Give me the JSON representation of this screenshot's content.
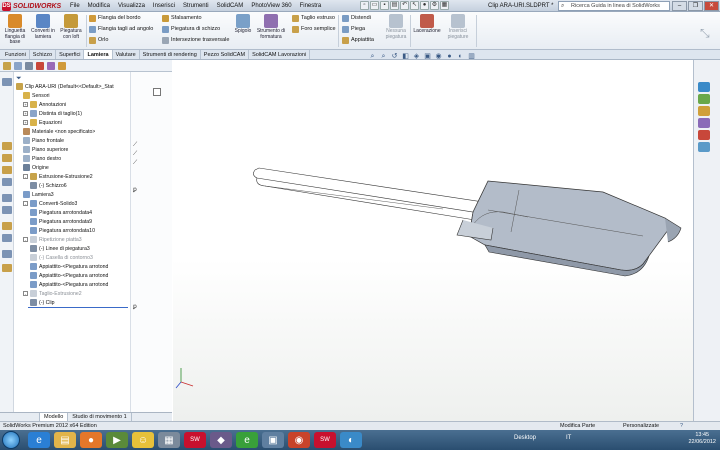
{
  "titlebar": {
    "logo": "SOLIDWORKS",
    "menu": [
      "File",
      "Modifica",
      "Visualizza",
      "Inserisci",
      "Strumenti",
      "SolidCAM",
      "PhotoView 360",
      "Finestra"
    ],
    "document_title": "Clip ARA-URI.SLDPRT *",
    "search_placeholder": "Ricerca Guida in linea di SolidWorks"
  },
  "ribbon": {
    "big_buttons": [
      {
        "label": "Linguetta flangia di base",
        "color": "#d98a2a"
      },
      {
        "label": "Converti in lamiera",
        "color": "#5a86c5"
      },
      {
        "label": "Piegatura con loft",
        "color": "#c59a3a"
      },
      {
        "label": "Spigolo",
        "color": "#7aa0c8"
      },
      {
        "label": "Strumento di formatura",
        "color": "#8f6fb0"
      },
      {
        "label": "Nessuna piegatura",
        "color": "#b7c2cf"
      },
      {
        "label": "Lacerazione",
        "color": "#c05a4a"
      },
      {
        "label": "Inserisci piegature",
        "color": "#b7c2cf"
      }
    ],
    "col1": [
      "Flangia del bordo",
      "Flangia tagli ad angolo",
      "Orlo"
    ],
    "col2": [
      "Sfalsamento",
      "Piegatura di schizzo",
      "Intersezione trasversale"
    ],
    "col3": [
      "Taglio estruso",
      "Foro semplice"
    ],
    "col4": [
      "Distendi",
      "Piega",
      "Appiattita"
    ]
  },
  "tabs": [
    "Funzioni",
    "Schizzo",
    "Superfici",
    "Lamiera",
    "Valutare",
    "Strumenti di rendering",
    "Pezzo SolidCAM",
    "SolidCAM Lavorazioni"
  ],
  "active_tab": "Lamiera",
  "tree": [
    {
      "label": "Clip ARA-URI  (Default<<Default>_Stat",
      "indent": 0,
      "expander": "",
      "icon": "#c7a34a",
      "grey": false
    },
    {
      "label": "Sensori",
      "indent": 1,
      "expander": "",
      "icon": "#d8b24a",
      "grey": false
    },
    {
      "label": "Annotazioni",
      "indent": 1,
      "expander": "+",
      "icon": "#d8b24a",
      "grey": false
    },
    {
      "label": "Distinta di taglio(1)",
      "indent": 1,
      "expander": "+",
      "icon": "#8aa4c8",
      "grey": false
    },
    {
      "label": "Equazioni",
      "indent": 1,
      "expander": "+",
      "icon": "#d8b24a",
      "grey": false
    },
    {
      "label": "Materiale <non specificato>",
      "indent": 1,
      "expander": "",
      "icon": "#b98a5a",
      "grey": false
    },
    {
      "label": "Piano frontale",
      "indent": 1,
      "expander": "",
      "icon": "#9cb0c8",
      "grey": false
    },
    {
      "label": "Piano superiore",
      "indent": 1,
      "expander": "",
      "icon": "#9cb0c8",
      "grey": false
    },
    {
      "label": "Piano destro",
      "indent": 1,
      "expander": "",
      "icon": "#9cb0c8",
      "grey": false
    },
    {
      "label": "Origine",
      "indent": 1,
      "expander": "",
      "icon": "#6b7f99",
      "grey": false
    },
    {
      "label": "Estrusione-Estrusione2",
      "indent": 1,
      "expander": "-",
      "icon": "#c7a34a",
      "grey": false
    },
    {
      "label": "(-) Schizzo6",
      "indent": 2,
      "expander": "",
      "icon": "#7d8da3",
      "grey": false
    },
    {
      "label": "Lamiera3",
      "indent": 1,
      "expander": "",
      "icon": "#7b9cc8",
      "grey": false
    },
    {
      "label": "Converti-Solido3",
      "indent": 1,
      "expander": "-",
      "icon": "#7b9cc8",
      "grey": false
    },
    {
      "label": "Piegatura arrotondata4",
      "indent": 2,
      "expander": "",
      "icon": "#7b9cc8",
      "grey": false
    },
    {
      "label": "Piegatura arrotondata9",
      "indent": 2,
      "expander": "",
      "icon": "#7b9cc8",
      "grey": false
    },
    {
      "label": "Piegatura arrotondata10",
      "indent": 2,
      "expander": "",
      "icon": "#7b9cc8",
      "grey": false
    },
    {
      "label": "Ripetizione piatta3",
      "indent": 1,
      "expander": "-",
      "icon": "#c8cfd8",
      "grey": true
    },
    {
      "label": "(-) Linee di piegatura3",
      "indent": 2,
      "expander": "",
      "icon": "#7d8da3",
      "grey": false
    },
    {
      "label": "(-) Casella di contorno3",
      "indent": 2,
      "expander": "",
      "icon": "#c8cfd8",
      "grey": true
    },
    {
      "label": "Appiattito-<Piegatura arrotond",
      "indent": 2,
      "expander": "",
      "icon": "#7b9cc8",
      "grey": false
    },
    {
      "label": "Appiattito-<Piegatura arrotond",
      "indent": 2,
      "expander": "",
      "icon": "#7b9cc8",
      "grey": false
    },
    {
      "label": "Appiattito-<Piegatura arrotond",
      "indent": 2,
      "expander": "",
      "icon": "#7b9cc8",
      "grey": false
    },
    {
      "label": "Taglio-Estrusione2",
      "indent": 1,
      "expander": "-",
      "icon": "#c8cfd8",
      "grey": true
    },
    {
      "label": "(-) Clip",
      "indent": 2,
      "expander": "",
      "icon": "#7d8da3",
      "grey": false
    }
  ],
  "panel_tabs": [
    "Modello",
    "Studio di movimento 1"
  ],
  "statusbar": {
    "left": "SolidWorks Premium 2012 x64 Edition",
    "mid": "Modifica Parte",
    "right": "Personalizzate"
  },
  "taskbar": {
    "icons": [
      {
        "name": "ie-icon",
        "glyph": "e",
        "color": "#2a7fd4"
      },
      {
        "name": "folder-icon",
        "glyph": "▤",
        "color": "#e1b44a"
      },
      {
        "name": "firefox-icon",
        "glyph": "●",
        "color": "#e4772a"
      },
      {
        "name": "media-icon",
        "glyph": "▶",
        "color": "#5a8a3a"
      },
      {
        "name": "chat-icon",
        "glyph": "☺",
        "color": "#e7c13a"
      },
      {
        "name": "calc-icon",
        "glyph": "▦",
        "color": "#7b8a9b"
      },
      {
        "name": "solidworks-icon",
        "glyph": "SW",
        "color": "#c8102e"
      },
      {
        "name": "app-icon",
        "glyph": "◆",
        "color": "#6a5a8a"
      },
      {
        "name": "edge-icon",
        "glyph": "e",
        "color": "#39a03a"
      },
      {
        "name": "tools-icon",
        "glyph": "▣",
        "color": "#5f7fa0"
      },
      {
        "name": "globe-icon",
        "glyph": "◉",
        "color": "#c8432a"
      },
      {
        "name": "solidworks2-icon",
        "glyph": "SW",
        "color": "#c8102e"
      },
      {
        "name": "media2-icon",
        "glyph": "◐",
        "color": "#3a8ac8"
      }
    ],
    "desktop_label": "Desktop",
    "lang": "IT",
    "time": "13:45",
    "date": "22/06/2012"
  }
}
